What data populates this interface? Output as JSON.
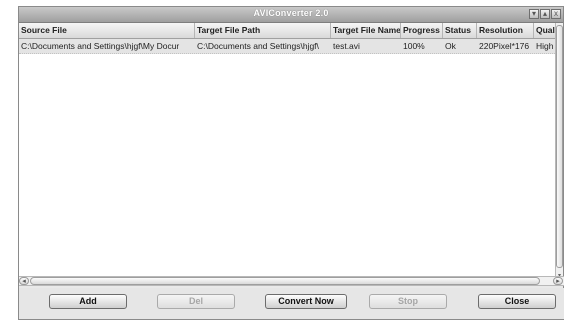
{
  "window": {
    "title": "AVIConverter 2.0",
    "controls": [
      "▾",
      "▴",
      "x"
    ]
  },
  "table": {
    "columns": [
      "Source File",
      "Target File Path",
      "Target File Name",
      "Progress",
      "Status",
      "Resolution",
      "Qual"
    ],
    "rows": [
      [
        "C:\\Documents and Settings\\hjgf\\My Docur",
        "C:\\Documents and Settings\\hjgf\\",
        "test.avi",
        "100%",
        "Ok",
        "220Pixel*176",
        "High"
      ]
    ]
  },
  "buttons": {
    "add": "Add",
    "del": "Del",
    "convert_now": "Convert Now",
    "stop": "Stop",
    "close": "Close"
  },
  "icons": {
    "scroll_left": "◂",
    "scroll_right": "▸",
    "scroll_up": "▴",
    "scroll_down": "▾"
  },
  "colors": {
    "selected_row": "#e4e4e4",
    "window_bg": "#e9e9e9"
  }
}
